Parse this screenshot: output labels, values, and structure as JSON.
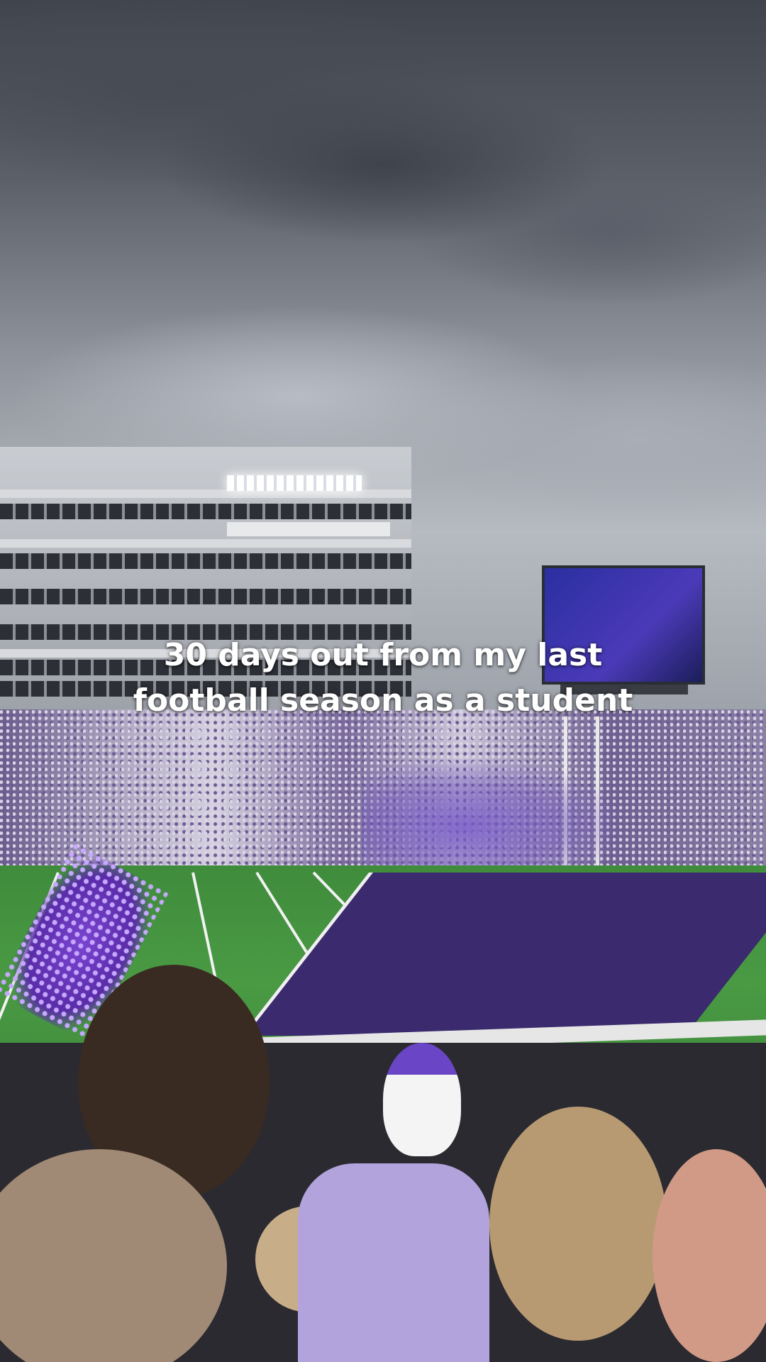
{
  "caption": {
    "line1": "30 days out from my last",
    "line2": "football season as a student"
  }
}
